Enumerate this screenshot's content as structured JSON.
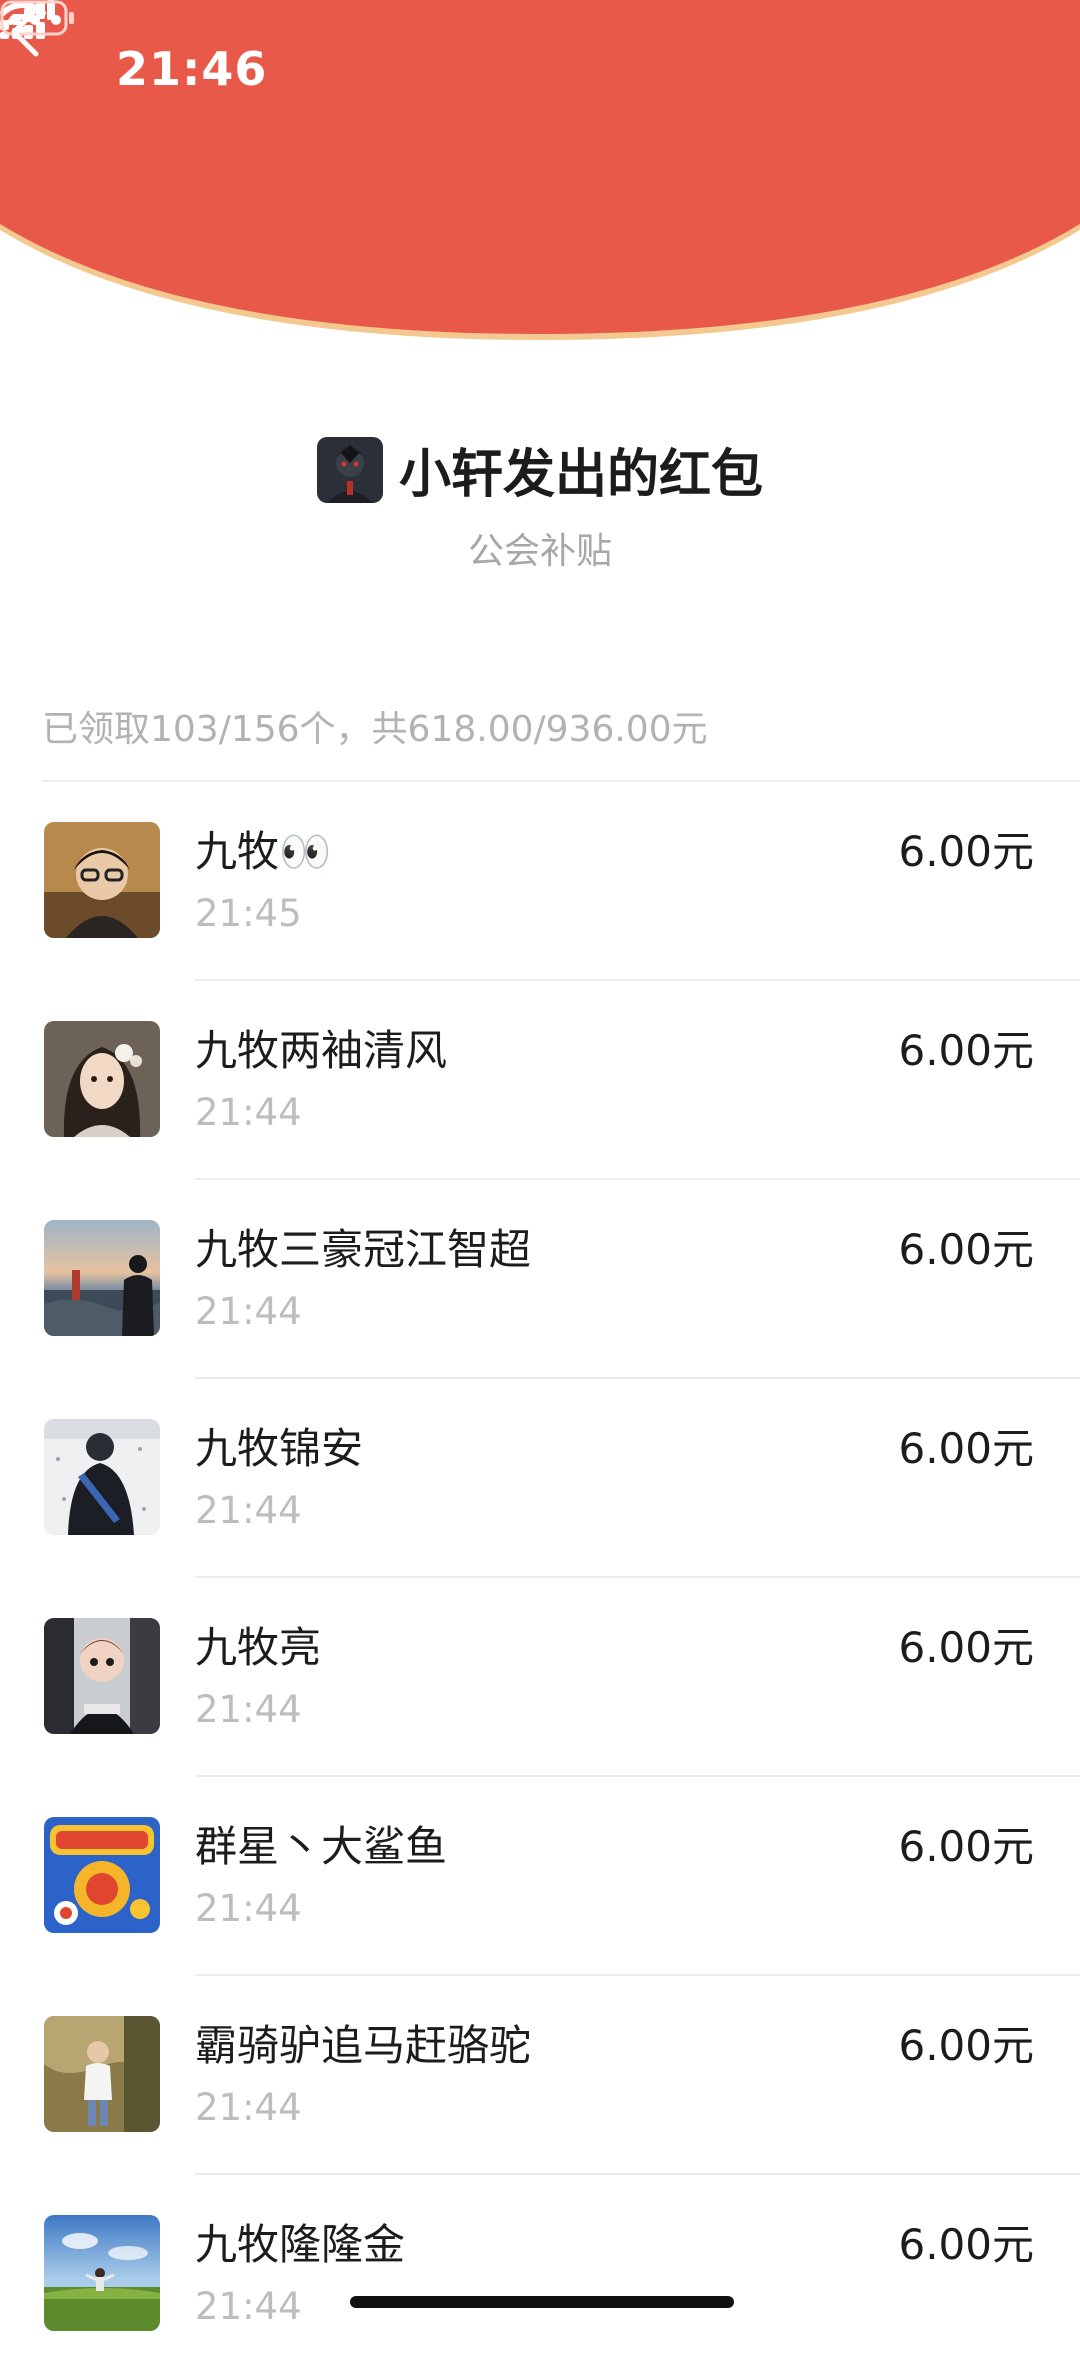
{
  "status_bar": {
    "time": "21:46"
  },
  "colors": {
    "header_red": "#e9594a",
    "header_rim": "#f3c98f",
    "amount_text": "#1c1c1c",
    "muted_text": "#b2b2b2"
  },
  "header": {
    "back_icon": "chevron-left-icon",
    "more_icon": "more-horizontal-icon"
  },
  "sender": {
    "title": "小轩发出的红包",
    "blessing": "公会补贴"
  },
  "summary": "已领取103/156个，共618.00/936.00元",
  "recipients": [
    {
      "name": "九牧👀",
      "time": "21:45",
      "amount": "6.00元"
    },
    {
      "name": "九牧两袖清风",
      "time": "21:44",
      "amount": "6.00元"
    },
    {
      "name": "九牧三豪冠江智超",
      "time": "21:44",
      "amount": "6.00元"
    },
    {
      "name": "九牧锦安",
      "time": "21:44",
      "amount": "6.00元"
    },
    {
      "name": "九牧亮",
      "time": "21:44",
      "amount": "6.00元"
    },
    {
      "name": "群星丶大鲨鱼",
      "time": "21:44",
      "amount": "6.00元"
    },
    {
      "name": "霸骑驴追马赶骆驼",
      "time": "21:44",
      "amount": "6.00元"
    },
    {
      "name": "九牧隆隆金",
      "time": "21:44",
      "amount": "6.00元"
    }
  ]
}
